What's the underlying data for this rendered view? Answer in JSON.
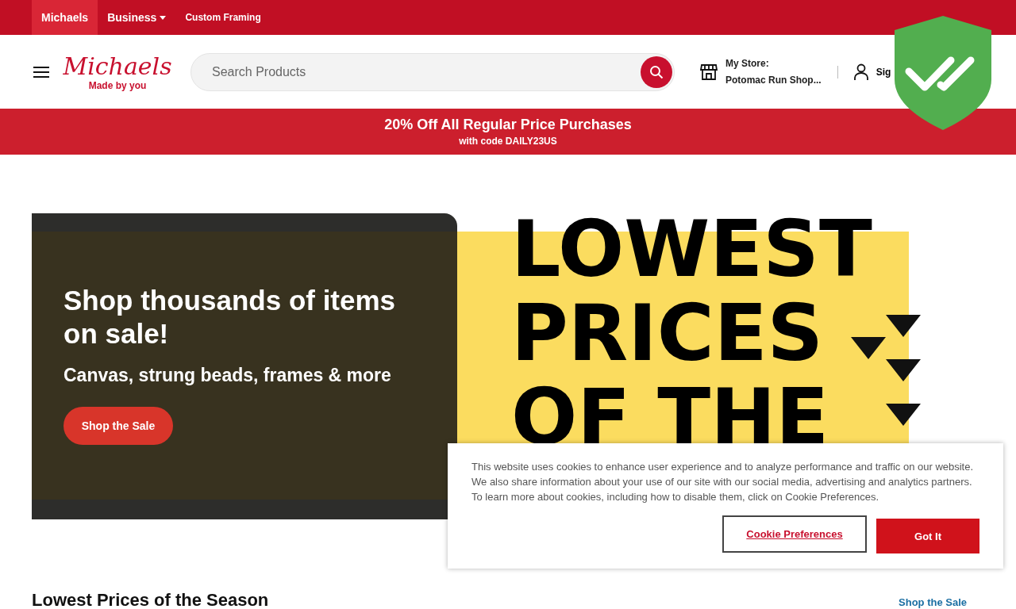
{
  "top_nav": [
    {
      "label": "Michaels",
      "selected": true,
      "dropdown": false
    },
    {
      "label": "Business",
      "selected": false,
      "dropdown": true
    },
    {
      "label": "Custom Framing",
      "selected": false,
      "dropdown": false
    }
  ],
  "header": {
    "logo": "Michaels",
    "tagline": "Made by you",
    "search": {
      "placeholder": "Search Products"
    },
    "store": {
      "label": "My Store:",
      "name": "Potomac Run Shop..."
    },
    "account": "Sig"
  },
  "promo": {
    "title": "20% Off All Regular Price Purchases",
    "subtitle": "with code DAILY23US"
  },
  "hero": {
    "title": "Shop thousands of items on sale!",
    "subtitle": "Canvas, strung beads, frames & more",
    "button": "Shop the Sale",
    "big_text": [
      "LOWEST",
      "PRICES",
      "OF THE"
    ]
  },
  "section": {
    "title": "Lowest Prices of the Season",
    "link": "Shop the Sale"
  },
  "cookie_notice": {
    "text": "This website uses cookies to enhance user experience and to analyze performance and traffic on our website. We also share information about your use of our site with our social media, advertising and analytics partners. To learn more about cookies, including how to disable them, click on Cookie Preferences.",
    "buttons": [
      {
        "label": "Cookie Preferences",
        "kind": "outline"
      },
      {
        "label": "Got It",
        "kind": "primary"
      }
    ]
  }
}
